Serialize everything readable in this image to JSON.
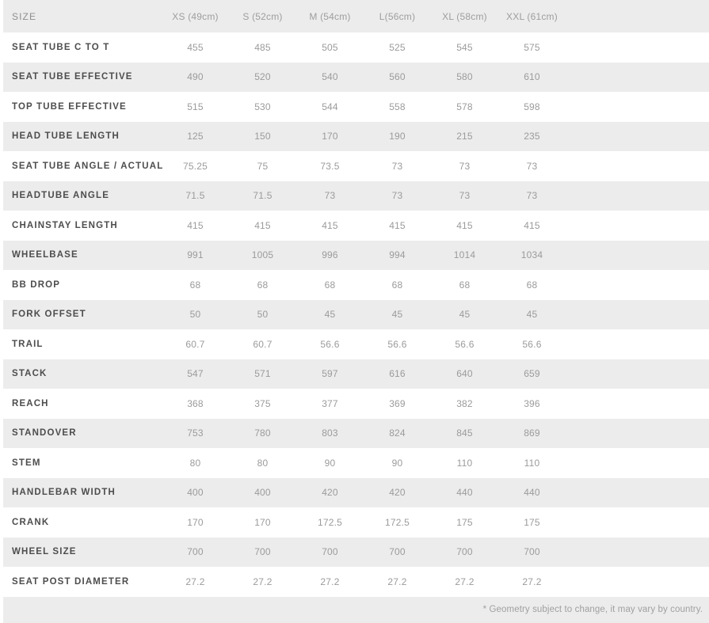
{
  "table": {
    "label_header": "SIZE",
    "size_columns": [
      "XS (49cm)",
      "S (52cm)",
      "M (54cm)",
      "L(56cm)",
      "XL (58cm)",
      "XXL (61cm)"
    ],
    "rows": [
      {
        "label": "SEAT TUBE C TO T",
        "values": [
          "455",
          "485",
          "505",
          "525",
          "545",
          "575"
        ]
      },
      {
        "label": "SEAT TUBE EFFECTIVE",
        "values": [
          "490",
          "520",
          "540",
          "560",
          "580",
          "610"
        ]
      },
      {
        "label": "TOP TUBE EFFECTIVE",
        "values": [
          "515",
          "530",
          "544",
          "558",
          "578",
          "598"
        ]
      },
      {
        "label": "HEAD TUBE LENGTH",
        "values": [
          "125",
          "150",
          "170",
          "190",
          "215",
          "235"
        ]
      },
      {
        "label": "SEAT TUBE ANGLE / ACTUAL",
        "values": [
          "75.25",
          "75",
          "73.5",
          "73",
          "73",
          "73"
        ]
      },
      {
        "label": "HEADTUBE ANGLE",
        "values": [
          "71.5",
          "71.5",
          "73",
          "73",
          "73",
          "73"
        ]
      },
      {
        "label": "CHAINSTAY LENGTH",
        "values": [
          "415",
          "415",
          "415",
          "415",
          "415",
          "415"
        ]
      },
      {
        "label": "WHEELBASE",
        "values": [
          "991",
          "1005",
          "996",
          "994",
          "1014",
          "1034"
        ]
      },
      {
        "label": "BB DROP",
        "values": [
          "68",
          "68",
          "68",
          "68",
          "68",
          "68"
        ]
      },
      {
        "label": "FORK OFFSET",
        "values": [
          "50",
          "50",
          "45",
          "45",
          "45",
          "45"
        ]
      },
      {
        "label": "TRAIL",
        "values": [
          "60.7",
          "60.7",
          "56.6",
          "56.6",
          "56.6",
          "56.6"
        ]
      },
      {
        "label": "STACK",
        "values": [
          "547",
          "571",
          "597",
          "616",
          "640",
          "659"
        ]
      },
      {
        "label": "REACH",
        "values": [
          "368",
          "375",
          "377",
          "369",
          "382",
          "396"
        ]
      },
      {
        "label": "STANDOVER",
        "values": [
          "753",
          "780",
          "803",
          "824",
          "845",
          "869"
        ]
      },
      {
        "label": "STEM",
        "values": [
          "80",
          "80",
          "90",
          "90",
          "110",
          "110"
        ]
      },
      {
        "label": "HANDLEBAR WIDTH",
        "values": [
          "400",
          "400",
          "420",
          "420",
          "440",
          "440"
        ]
      },
      {
        "label": "CRANK",
        "values": [
          "170",
          "170",
          "172.5",
          "172.5",
          "175",
          "175"
        ]
      },
      {
        "label": "WHEEL SIZE",
        "values": [
          "700",
          "700",
          "700",
          "700",
          "700",
          "700"
        ]
      },
      {
        "label": "SEAT POST DIAMETER",
        "values": [
          "27.2",
          "27.2",
          "27.2",
          "27.2",
          "27.2",
          "27.2"
        ]
      }
    ],
    "footnote": "* Geometry subject to change, it may vary by country.",
    "colors": {
      "stripe": "#ececec",
      "base": "#ffffff",
      "label_text": "#4d4d4d",
      "value_text": "#9b9b9b",
      "header_text": "#9a9a9a"
    }
  }
}
